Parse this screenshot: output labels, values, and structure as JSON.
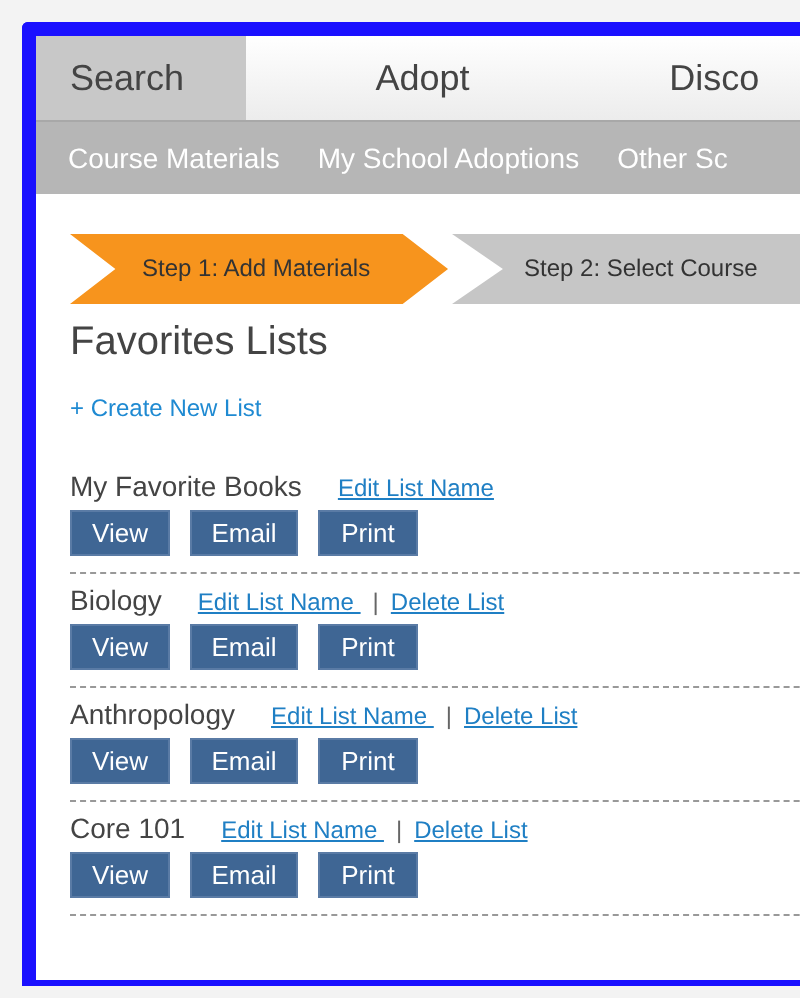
{
  "tabs": [
    {
      "label": "Search",
      "selected": true
    },
    {
      "label": "Adopt",
      "selected": false
    },
    {
      "label": "Disco",
      "selected": false
    }
  ],
  "subnav": [
    "Course Materials",
    "My School Adoptions",
    "Other Sc"
  ],
  "steps": [
    {
      "label": "Step 1: Add Materials",
      "selected": true
    },
    {
      "label": "Step 2: Select Course",
      "selected": false
    }
  ],
  "title": "Favorites Lists",
  "create_link": "+ Create New List",
  "lists": [
    {
      "name": "My Favorite Books",
      "links": [
        "Edit List Name"
      ],
      "buttons": [
        "View",
        "Email",
        "Print"
      ]
    },
    {
      "name": "Biology",
      "links": [
        "Edit List Name ",
        "Delete List"
      ],
      "buttons": [
        "View",
        "Email",
        "Print"
      ]
    },
    {
      "name": "Anthropology",
      "links": [
        "Edit List Name ",
        "Delete List"
      ],
      "buttons": [
        "View",
        "Email",
        "Print"
      ]
    },
    {
      "name": "Core 101",
      "links": [
        "Edit List Name ",
        "Delete List"
      ],
      "buttons": [
        "View",
        "Email",
        "Print"
      ]
    }
  ],
  "link_separator": "|"
}
